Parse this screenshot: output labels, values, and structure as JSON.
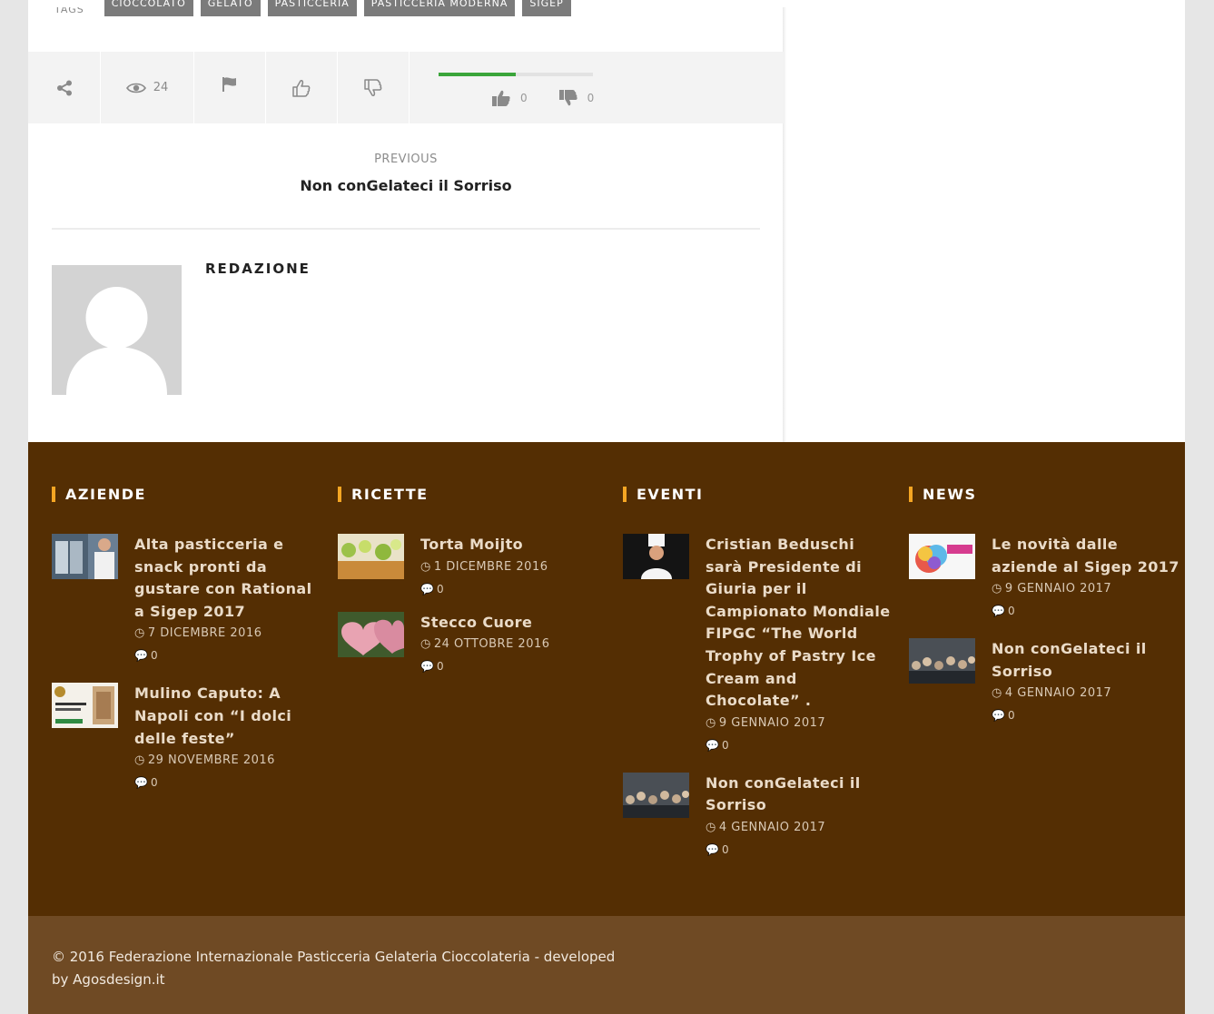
{
  "tags": {
    "label": "TAGS",
    "items": [
      "CIOCCOLATO",
      "GELATO",
      "PASTICCERIA",
      "PASTICCERIA MODERNA",
      "SIGEP"
    ]
  },
  "actions": {
    "views": "24",
    "likes": "0",
    "dislikes": "0",
    "rating_fraction": 0.5
  },
  "previous": {
    "label": "PREVIOUS",
    "title": "Non conGelateci il Sorriso"
  },
  "author": {
    "name": "REDAZIONE"
  },
  "colors": {
    "footer_bg": "#542e03",
    "footer_bottom_bg": "#6f4a24",
    "accent": "#f5a623",
    "rating_green": "#3aa53a"
  },
  "footer": {
    "columns": [
      {
        "title": "AZIENDE",
        "items": [
          {
            "title": "Alta pasticceria e snack pronti da gustare con Rational a Sigep 2017",
            "date": "7 DICEMBRE 2016",
            "comments": "0"
          },
          {
            "title": "Mulino Caputo: A Napoli con “I dolci delle feste”",
            "date": "29 NOVEMBRE 2016",
            "comments": "0"
          }
        ]
      },
      {
        "title": "RICETTE",
        "items": [
          {
            "title": "Torta Moijto",
            "date": "1 DICEMBRE 2016",
            "comments": "0"
          },
          {
            "title": "Stecco Cuore",
            "date": "24 OTTOBRE 2016",
            "comments": "0"
          }
        ]
      },
      {
        "title": "EVENTI",
        "items": [
          {
            "title": "Cristian Beduschi sarà Presidente di Giuria per il Campionato Mondiale FIPGC “The World Trophy of Pastry Ice Cream and Chocolate” .",
            "date": "9 GENNAIO 2017",
            "comments": "0"
          },
          {
            "title": "Non conGelateci il Sorriso",
            "date": "4 GENNAIO 2017",
            "comments": "0"
          }
        ]
      },
      {
        "title": "NEWS",
        "items": [
          {
            "title": "Le novità dalle aziende al Sigep 2017",
            "date": "9 GENNAIO 2017",
            "comments": "0"
          },
          {
            "title": "Non conGelateci il Sorriso",
            "date": "4 GENNAIO 2017",
            "comments": "0"
          }
        ]
      }
    ],
    "copyright": "© 2016 Federazione Internazionale Pasticceria Gelateria Cioccolateria - developed by Agosdesign.it"
  }
}
